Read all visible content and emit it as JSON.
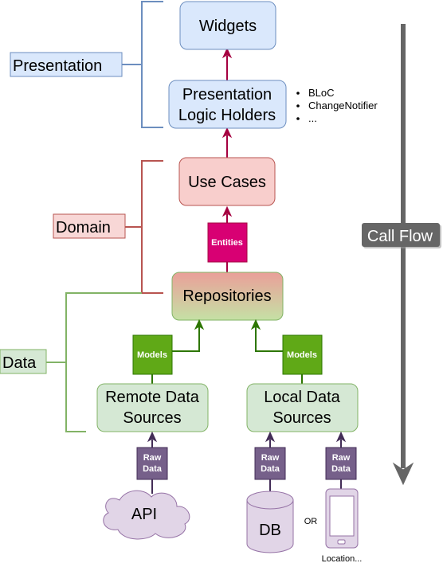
{
  "layers": {
    "presentation": {
      "label": "Presentation",
      "fill": "#dae8fc",
      "stroke": "#6c8ebf"
    },
    "domain": {
      "label": "Domain",
      "fill": "#f8d7d6",
      "stroke": "#b85450"
    },
    "data": {
      "label": "Data",
      "fill": "#d5e8d4",
      "stroke": "#82b366"
    }
  },
  "nodes": {
    "widgets": "Widgets",
    "logic_holders": {
      "line1": "Presentation",
      "line2": "Logic Holders"
    },
    "use_cases": "Use Cases",
    "repositories": "Repositories",
    "remote_sources": {
      "line1": "Remote Data",
      "line2": "Sources"
    },
    "local_sources": {
      "line1": "Local Data",
      "line2": "Sources"
    },
    "api": "API",
    "db": "DB",
    "or_label": "OR",
    "device_label": "Location..."
  },
  "logic_holder_examples": [
    "BLoC",
    "ChangeNotifier",
    "..."
  ],
  "tags": {
    "entities": "Entities",
    "models": "Models",
    "raw_data": {
      "line1": "Raw",
      "line2": "Data"
    }
  },
  "call_flow": {
    "label": "Call Flow"
  },
  "colors": {
    "arrow_presentation": "#a50040",
    "entities_fill": "#d80073",
    "models_fill": "#60a917",
    "models_stroke": "#2d7600",
    "raw_fill": "#76608a",
    "raw_stroke": "#432d57",
    "source_fill": "#e1d5e7",
    "source_stroke": "#9673a6",
    "call_flow": "#666666"
  }
}
